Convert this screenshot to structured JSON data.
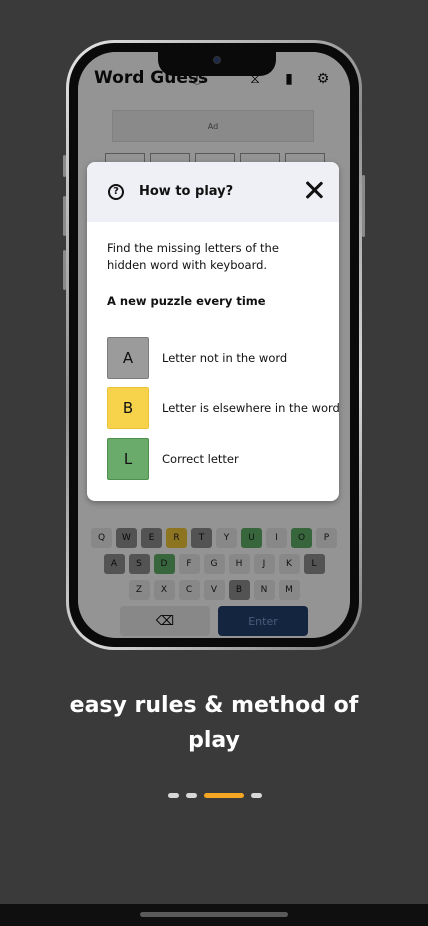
{
  "app": {
    "title": "Word Guess",
    "ad_label": "Ad"
  },
  "keyboard": {
    "rows": [
      [
        {
          "k": "Q",
          "s": ""
        },
        {
          "k": "W",
          "s": "grey"
        },
        {
          "k": "E",
          "s": "grey"
        },
        {
          "k": "R",
          "s": "yellow"
        },
        {
          "k": "T",
          "s": "grey"
        },
        {
          "k": "Y",
          "s": ""
        },
        {
          "k": "U",
          "s": "green"
        },
        {
          "k": "I",
          "s": ""
        },
        {
          "k": "O",
          "s": "green"
        },
        {
          "k": "P",
          "s": ""
        }
      ],
      [
        {
          "k": "A",
          "s": "grey"
        },
        {
          "k": "S",
          "s": "grey"
        },
        {
          "k": "D",
          "s": "green"
        },
        {
          "k": "F",
          "s": ""
        },
        {
          "k": "G",
          "s": ""
        },
        {
          "k": "H",
          "s": ""
        },
        {
          "k": "J",
          "s": ""
        },
        {
          "k": "K",
          "s": ""
        },
        {
          "k": "L",
          "s": "grey"
        }
      ],
      [
        {
          "k": "Z",
          "s": ""
        },
        {
          "k": "X",
          "s": ""
        },
        {
          "k": "C",
          "s": ""
        },
        {
          "k": "V",
          "s": ""
        },
        {
          "k": "B",
          "s": "grey"
        },
        {
          "k": "N",
          "s": ""
        },
        {
          "k": "M",
          "s": ""
        }
      ]
    ],
    "enter_label": "Enter",
    "delete_glyph": "⌫"
  },
  "modal": {
    "title": "How to play?",
    "help_glyph": "?",
    "description": "Find the missing letters of the hidden word with keyboard.",
    "subtitle": "A new puzzle every time",
    "legend": [
      {
        "letter": "A",
        "color": "grey",
        "text": "Letter not in the word"
      },
      {
        "letter": "B",
        "color": "yellow",
        "text": "Letter is elsewhere in the word"
      },
      {
        "letter": "L",
        "color": "green",
        "text": "Correct letter"
      }
    ]
  },
  "caption": {
    "line1": "easy rules & method of",
    "line2": "play"
  },
  "pager": {
    "count": 4,
    "active_index": 2
  },
  "colors": {
    "background": "#3a3a3a",
    "accent": "#f5a623",
    "enter_button": "#23406e"
  }
}
